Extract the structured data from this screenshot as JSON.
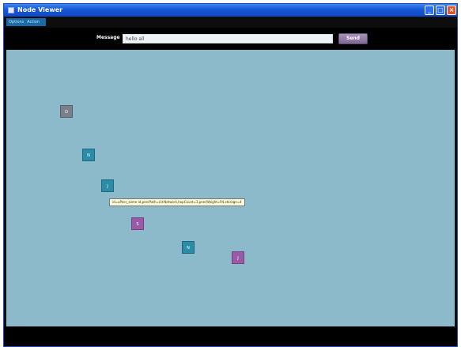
{
  "window": {
    "title": "Node Viewer",
    "controls": {
      "minimize": "_",
      "maximize": "□",
      "close": "×"
    }
  },
  "menu": {
    "items": [
      "Options",
      "Action"
    ]
  },
  "toolbar": {
    "message_label": "Message",
    "message_value": "hello all",
    "send_label": "Send"
  },
  "canvas": {
    "background": "#8cbacb",
    "nodes": [
      {
        "label": "D",
        "color": "#7a7f8c"
      },
      {
        "label": "N",
        "color": "#2a8ca8"
      },
      {
        "label": "J",
        "color": "#2a8ca8"
      },
      {
        "label": "S",
        "color": "#9a5aa8"
      },
      {
        "label": "N",
        "color": "#2a8ca8"
      },
      {
        "label": "J",
        "color": "#9a5aa8"
      }
    ],
    "tooltip": "id=uPeer_some-id,peerPath=/id:Network,hopCount=3,peerWeight=94,storage=4"
  }
}
